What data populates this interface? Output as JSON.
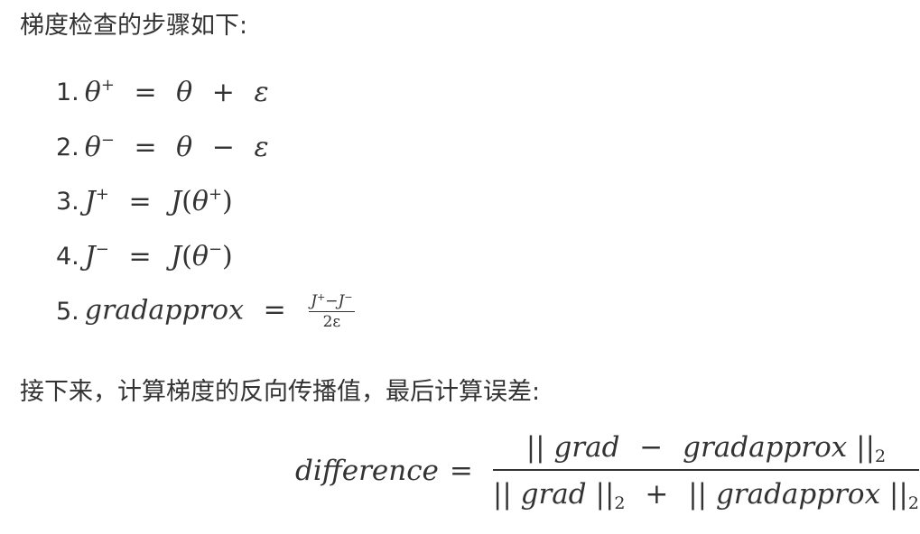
{
  "intro": "梯度检查的步骤如下:",
  "steps": [
    {
      "n": "1.",
      "lhs": "θ",
      "lhs_sup": "+",
      "rhs_a": "θ",
      "op": "+",
      "rhs_b": "ε"
    },
    {
      "n": "2.",
      "lhs": "θ",
      "lhs_sup": "−",
      "rhs_a": "θ",
      "op": "−",
      "rhs_b": "ε"
    },
    {
      "n": "3.",
      "lhs": "J",
      "lhs_sup": "+",
      "fn": "J",
      "arg": "θ",
      "arg_sup": "+"
    },
    {
      "n": "4.",
      "lhs": "J",
      "lhs_sup": "−",
      "fn": "J",
      "arg": "θ",
      "arg_sup": "−"
    },
    {
      "n": "5.",
      "lhs": "gradapprox",
      "num_a": "J",
      "num_a_sup": "+",
      "num_op": "−",
      "num_b": "J",
      "num_b_sup": "−",
      "den": "2ε"
    }
  ],
  "after": "接下来，计算梯度的反向传播值，最后计算误差:",
  "formula": {
    "lhs": "difference",
    "eq": "=",
    "numerator": {
      "bar_l": "||",
      "a": "grad",
      "op": "−",
      "b": "gradapprox",
      "bar_r": "||",
      "sub": "2"
    },
    "denominator": {
      "bar1_l": "||",
      "a": "grad",
      "bar1_r": "||",
      "sub1": "2",
      "op": "+",
      "bar2_l": "||",
      "b": "gradapprox",
      "bar2_r": "||",
      "sub2": "2"
    }
  }
}
